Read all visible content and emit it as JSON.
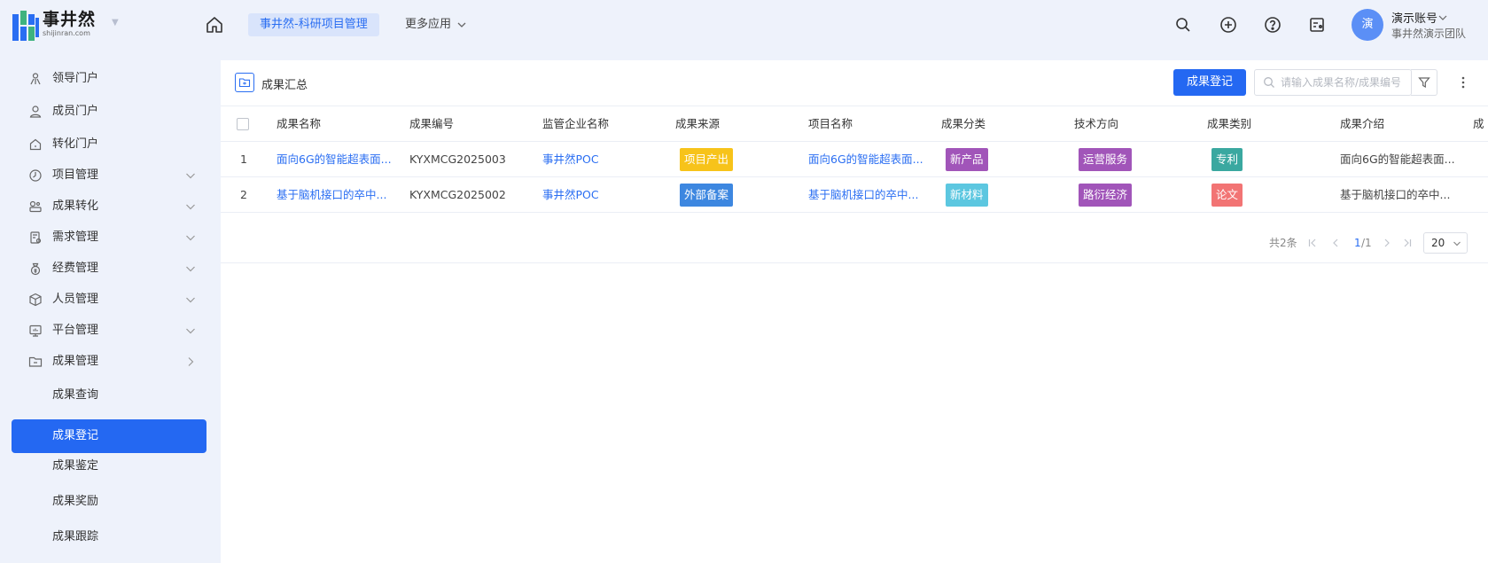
{
  "brand": {
    "name_cn": "事井然",
    "name_en": "shijinran.com",
    "colors": {
      "blue": "#2a6ef2",
      "green": "#3fb37f",
      "active": "#2468f2"
    }
  },
  "header": {
    "active_app": "事井然-科研项目管理",
    "more_apps": "更多应用",
    "icons": [
      "home-icon",
      "search-icon",
      "plus-circle-icon",
      "help-icon",
      "notice-icon"
    ],
    "user": {
      "avatar": "演",
      "name": "演示账号",
      "team": "事井然演示团队"
    }
  },
  "sidebar": {
    "items": [
      {
        "label": "领导门户",
        "icon": "leader-icon",
        "expandable": false
      },
      {
        "label": "成员门户",
        "icon": "member-icon",
        "expandable": false
      },
      {
        "label": "转化门户",
        "icon": "home-outline-icon",
        "expandable": false
      },
      {
        "label": "项目管理",
        "icon": "clock-icon",
        "expandable": true
      },
      {
        "label": "成果转化",
        "icon": "transfer-icon",
        "expandable": true
      },
      {
        "label": "需求管理",
        "icon": "doc-icon",
        "expandable": true
      },
      {
        "label": "经费管理",
        "icon": "money-bag-icon",
        "expandable": true
      },
      {
        "label": "人员管理",
        "icon": "cube-icon",
        "expandable": true
      },
      {
        "label": "平台管理",
        "icon": "monitor-icon",
        "expandable": true
      },
      {
        "label": "成果管理",
        "icon": "folder-icon",
        "expandable": true,
        "expanded": true
      }
    ],
    "sub_items": [
      {
        "label": "成果查询",
        "active": false
      },
      {
        "label": "成果登记",
        "active": true
      },
      {
        "label": "成果鉴定",
        "active": false
      },
      {
        "label": "成果奖励",
        "active": false
      },
      {
        "label": "成果跟踪",
        "active": false
      }
    ]
  },
  "main": {
    "title": "成果汇总",
    "register_button": "成果登记",
    "search_placeholder": "请输入成果名称/成果编号",
    "table": {
      "columns": [
        "成果名称",
        "成果编号",
        "监管企业名称",
        "成果来源",
        "项目名称",
        "成果分类",
        "技术方向",
        "成果类别",
        "成果介绍",
        "成"
      ],
      "rows": [
        {
          "index": "1",
          "name": "面向6G的智能超表面...",
          "code": "KYXMCG2025003",
          "company": "事井然POC",
          "source": {
            "text": "项目产出",
            "color": "#f7c31a"
          },
          "project": "面向6G的智能超表面...",
          "category": {
            "text": "新产品",
            "color": "#a155b9"
          },
          "direction": {
            "text": "运营服务",
            "color": "#a155b9"
          },
          "type": {
            "text": "专利",
            "color": "#3aa8a0"
          },
          "intro": "面向6G的智能超表面..."
        },
        {
          "index": "2",
          "name": "基于脑机接口的卒中...",
          "code": "KYXMCG2025002",
          "company": "事井然POC",
          "source": {
            "text": "外部备案",
            "color": "#3d87e0"
          },
          "project": "基于脑机接口的卒中...",
          "category": {
            "text": "新材料",
            "color": "#5cc7e0"
          },
          "direction": {
            "text": "路衍经济",
            "color": "#a155b9"
          },
          "type": {
            "text": "论文",
            "color": "#f27474"
          },
          "intro": "基于脑机接口的卒中..."
        }
      ]
    },
    "pagination": {
      "total": "共2条",
      "current": "1",
      "pages": "/1",
      "page_size": "20"
    }
  }
}
